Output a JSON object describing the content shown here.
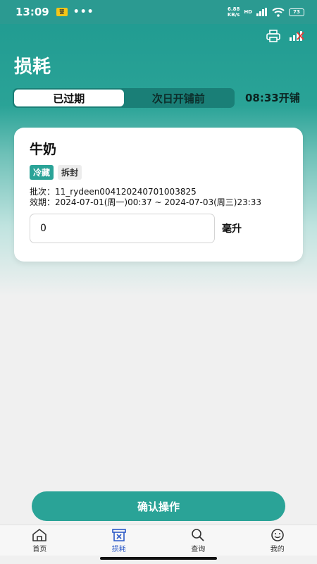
{
  "status_bar": {
    "time": "13:09",
    "notif_badge": "营",
    "dots": "•••",
    "net_speed_value": "6.88",
    "net_speed_unit": "KB/s",
    "network": "HD",
    "battery": "73"
  },
  "header": {
    "title": "损耗",
    "tabs": [
      {
        "label": "已过期",
        "active": true
      },
      {
        "label": "次日开铺前",
        "active": false
      }
    ],
    "open_time": "08:33开铺"
  },
  "card": {
    "title": "牛奶",
    "tags": [
      "冷藏",
      "拆封"
    ],
    "batch_label": "批次：",
    "batch_value": "11_rydeen004120240701003825",
    "expiry_label": "效期：",
    "expiry_value": "2024-07-01(周一)00:37 ~ 2024-07-03(周三)23:33",
    "quantity_value": "0",
    "unit": "毫升"
  },
  "confirm_button": "确认操作",
  "bottom_nav": [
    {
      "label": "首页",
      "icon": "home-icon",
      "active": false
    },
    {
      "label": "损耗",
      "icon": "waste-bin-icon",
      "active": true
    },
    {
      "label": "查询",
      "icon": "search-icon",
      "active": false
    },
    {
      "label": "我的",
      "icon": "smiley-profile-icon",
      "active": false
    }
  ],
  "colors": {
    "primary": "#2aa397",
    "active_nav": "#2c59c7"
  }
}
